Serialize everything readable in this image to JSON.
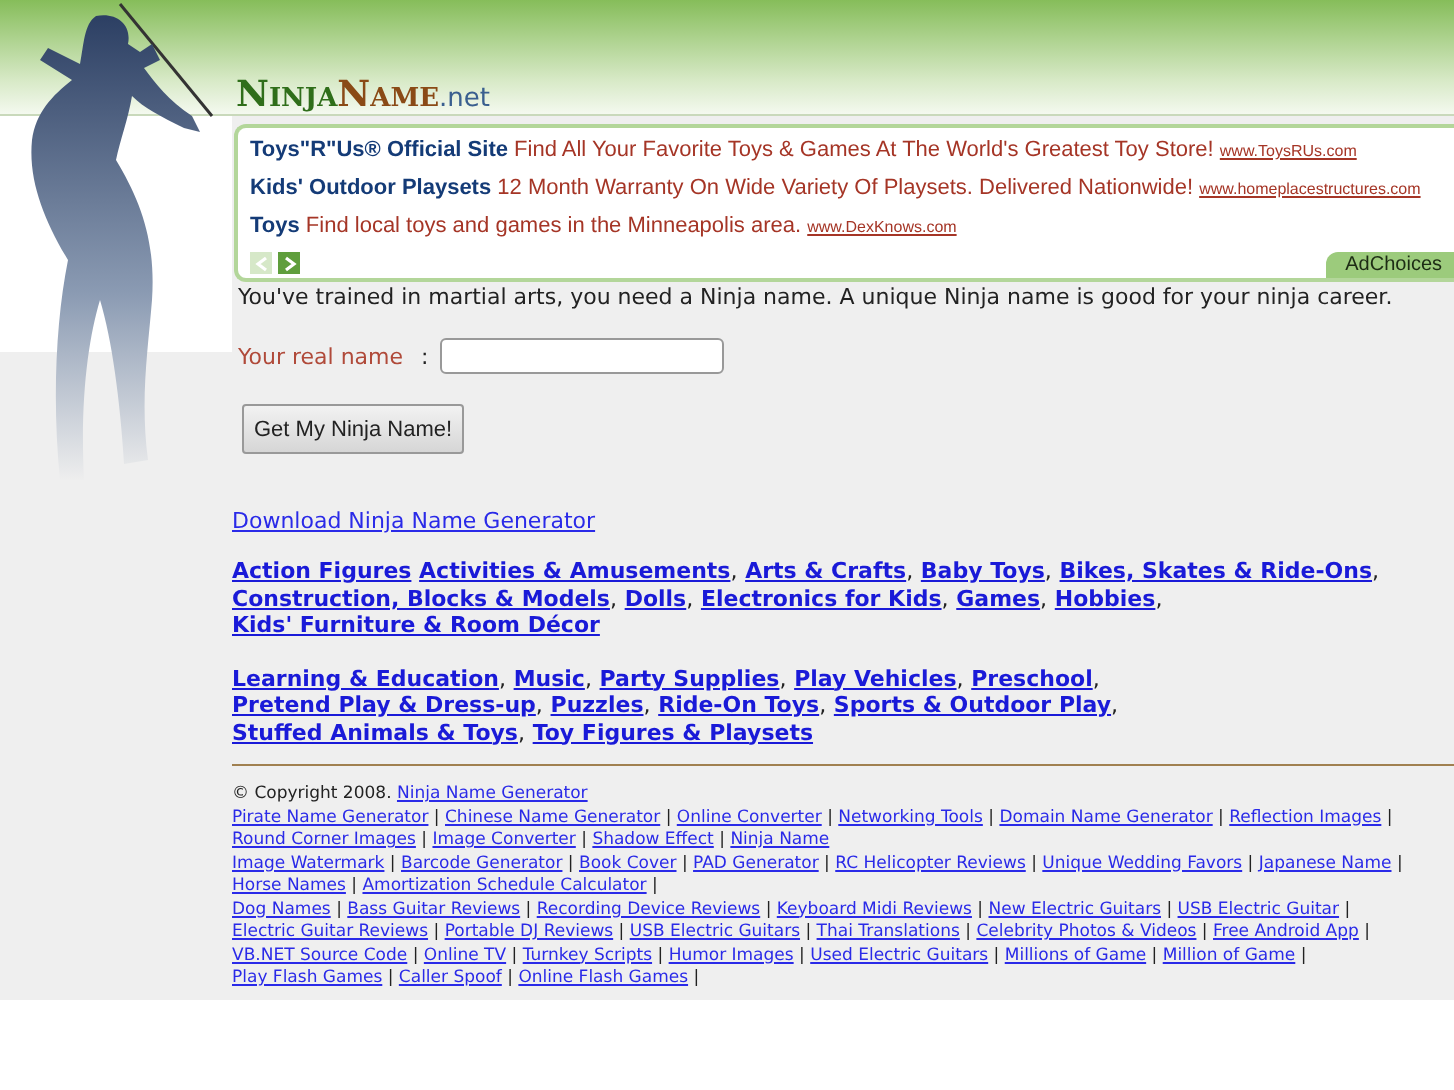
{
  "logo": {
    "parts": [
      "Ninja",
      "Name",
      ".net"
    ]
  },
  "ads": {
    "items": [
      {
        "title": "Toys\"R\"Us® Official Site",
        "text": "Find All Your Favorite Toys & Games At The World's Greatest Toy Store!",
        "url": "www.ToysRUs.com"
      },
      {
        "title": "Kids' Outdoor Playsets",
        "text": "12 Month Warranty On Wide Variety Of Playsets. Delivered Nationwide!",
        "url": "www.homeplacestructures.com"
      },
      {
        "title": "Toys",
        "text": "Find local toys and games in the Minneapolis area.",
        "url": "www.DexKnows.com"
      }
    ],
    "prev_disabled": true,
    "next_disabled": false,
    "adchoices": "AdChoices"
  },
  "intro": "You've trained in martial arts, you need a Ninja name. A unique Ninja name is good for your ninja career.",
  "form": {
    "label": "Your real name",
    "colon": ":",
    "button": "Get My Ninja Name!"
  },
  "download_link": "Download Ninja Name Generator",
  "categories": [
    [
      {
        "label": "Action Figures"
      },
      {
        "label": "Activities & Amusements",
        "sep": ","
      },
      {
        "label": "Arts & Crafts",
        "sep": ","
      },
      {
        "label": "Baby Toys",
        "sep": ","
      },
      {
        "label": "Bikes, Skates & Ride-Ons",
        "sep": ","
      },
      {
        "label": "Construction, Blocks & Models",
        "sep": ","
      },
      {
        "label": "Dolls",
        "sep": ","
      },
      {
        "label": "Electronics for Kids",
        "sep": ","
      },
      {
        "label": "Games",
        "sep": ","
      },
      {
        "label": "Hobbies",
        "sep": ","
      },
      {
        "label": "Kids' Furniture & Room Décor"
      }
    ],
    [
      {
        "label": "Learning & Education",
        "sep": ","
      },
      {
        "label": "Music",
        "sep": ","
      },
      {
        "label": "Party Supplies",
        "sep": ","
      },
      {
        "label": "Play Vehicles",
        "sep": ","
      },
      {
        "label": "Preschool",
        "sep": ","
      },
      {
        "label": "Pretend Play & Dress-up",
        "sep": ","
      },
      {
        "label": "Puzzles",
        "sep": ","
      },
      {
        "label": "Ride-On Toys",
        "sep": ","
      },
      {
        "label": "Sports & Outdoor Play",
        "sep": ","
      },
      {
        "label": "Stuffed Animals & Toys",
        "sep": ","
      },
      {
        "label": "Toy Figures & Playsets"
      }
    ]
  ],
  "footer": {
    "copyright": "© Copyright 2008.",
    "copyright_link": "Ninja Name Generator",
    "groups": [
      [
        {
          "label": "Pirate Name Generator",
          "sep": "|"
        },
        {
          "label": "Chinese Name Generator",
          "sep": "|"
        },
        {
          "label": "Online Converter",
          "sep": "|"
        },
        {
          "label": "Networking Tools",
          "sep": "|"
        },
        {
          "label": "Domain Name Generator",
          "sep": "|"
        },
        {
          "label": "Reflection Images",
          "sep": "|"
        },
        {
          "label": "Round Corner Images",
          "sep": "|"
        },
        {
          "label": "Image Converter",
          "sep": "|"
        },
        {
          "label": "Shadow Effect",
          "sep": "|"
        },
        {
          "label": "Ninja Name"
        }
      ],
      [
        {
          "label": "Image Watermark",
          "sep": "|"
        },
        {
          "label": "Barcode Generator",
          "sep": "|"
        },
        {
          "label": "Book Cover",
          "sep": "|"
        },
        {
          "label": "PAD Generator",
          "sep": "|"
        },
        {
          "label": "RC Helicopter Reviews",
          "sep": "|"
        },
        {
          "label": "Unique Wedding Favors",
          "sep": "|"
        },
        {
          "label": "Japanese Name",
          "sep": "|"
        },
        {
          "label": "Horse Names",
          "sep": "|"
        },
        {
          "label": "Amortization Schedule Calculator",
          "sep": "|"
        }
      ],
      [
        {
          "label": "Dog Names",
          "sep": "|"
        },
        {
          "label": "Bass Guitar Reviews",
          "sep": "|"
        },
        {
          "label": "Recording Device Reviews",
          "sep": "|"
        },
        {
          "label": "Keyboard Midi Reviews",
          "sep": "|"
        },
        {
          "label": "New Electric Guitars",
          "sep": "|"
        },
        {
          "label": "USB Electric Guitar",
          "sep": "|"
        },
        {
          "label": "Electric Guitar Reviews",
          "sep": "|"
        },
        {
          "label": "Portable DJ Reviews",
          "sep": "|"
        },
        {
          "label": "USB Electric Guitars",
          "sep": "|"
        },
        {
          "label": "Thai Translations",
          "sep": "|"
        },
        {
          "label": "Celebrity Photos & Videos",
          "sep": "|"
        },
        {
          "label": "Free Android App",
          "sep": "|"
        },
        {
          "label": "VB.NET Source Code",
          "sep": "|"
        },
        {
          "label": "Online TV",
          "sep": "|"
        },
        {
          "label": "Turnkey Scripts",
          "sep": "|"
        },
        {
          "label": "Humor Images",
          "sep": "|"
        },
        {
          "label": "Used Electric Guitars",
          "sep": "|"
        },
        {
          "label": "Millions of Game",
          "sep": "|"
        },
        {
          "label": "Million of Game",
          "sep": "|"
        },
        {
          "label": "Play Flash Games",
          "sep": "|"
        },
        {
          "label": "Caller Spoof",
          "sep": "|"
        },
        {
          "label": "Online Flash Games",
          "sep": "|"
        }
      ]
    ]
  }
}
